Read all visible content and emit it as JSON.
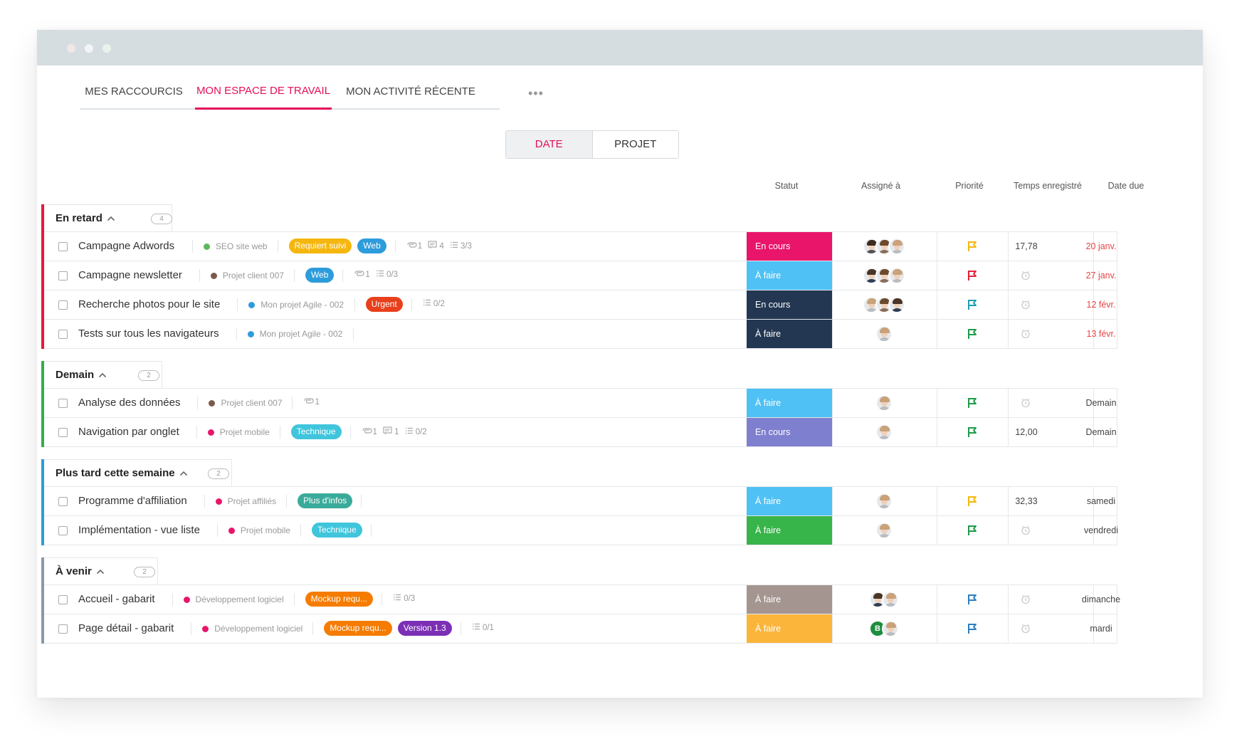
{
  "window": {
    "dots": [
      "#f2e6e8",
      "#f2f4f5",
      "#eaf3ea"
    ]
  },
  "tabs": [
    {
      "label": "MES RACCOURCIS",
      "active": false
    },
    {
      "label": "MON ESPACE DE TRAVAIL",
      "active": true
    },
    {
      "label": "MON ACTIVITÉ RÉCENTE",
      "active": false
    }
  ],
  "tabs_more": "•••",
  "view_toggle": {
    "date_label": "DATE",
    "project_label": "PROJET",
    "selected": "DATE"
  },
  "columns": {
    "status": "Statut",
    "assignee": "Assigné à",
    "priority": "Priorité",
    "time": "Temps enregistré",
    "due": "Date due"
  },
  "groups": [
    {
      "title": "En retard",
      "count": "4",
      "color": "#e8173a",
      "tasks": [
        {
          "name": "Campagne Adwords",
          "project": "SEO site web",
          "project_color": "#5cb85c",
          "tags": [
            {
              "label": "Requiert suivi",
              "color": "#f5b70f"
            },
            {
              "label": "Web",
              "color": "#2d9cdb"
            }
          ],
          "meta": {
            "attachments": "1",
            "comments": "4",
            "checklist": "3/3"
          },
          "status": "En cours",
          "status_color": "#e9156a",
          "assignees": [
            "p1",
            "p2",
            "p3"
          ],
          "priority_color": "#f5b70f",
          "time": "17,78",
          "due": "20 janv.",
          "due_late": true
        },
        {
          "name": "Campagne newsletter",
          "project": "Projet client 007",
          "project_color": "#7a5a4a",
          "tags": [
            {
              "label": "Web",
              "color": "#2d9cdb"
            }
          ],
          "meta": {
            "attachments": "1",
            "comments": "",
            "checklist": "0/3"
          },
          "status": "À faire",
          "status_color": "#4fc1f4",
          "assignees": [
            "p4",
            "p2",
            "p3"
          ],
          "priority_color": "#e5213b",
          "time": "",
          "due": "27 janv.",
          "due_late": true
        },
        {
          "name": "Recherche photos pour le site",
          "project": "Mon projet Agile - 002",
          "project_color": "#2d9cdb",
          "tags": [
            {
              "label": "Urgent",
              "color": "#e8401c"
            }
          ],
          "meta": {
            "attachments": "",
            "comments": "",
            "checklist": "0/2"
          },
          "status": "En cours",
          "status_color": "#233753",
          "assignees": [
            "p3",
            "p2",
            "p4"
          ],
          "priority_color": "#1a9fb0",
          "time": "",
          "due": "12 févr.",
          "due_late": true
        },
        {
          "name": "Tests sur tous les navigateurs",
          "project": "Mon projet Agile - 002",
          "project_color": "#2d9cdb",
          "tags": [],
          "meta": {
            "attachments": "",
            "comments": "",
            "checklist": ""
          },
          "status": "À faire",
          "status_color": "#233753",
          "assignees": [
            "p3"
          ],
          "priority_color": "#1e9b4a",
          "time": "",
          "due": "13 févr.",
          "due_late": true
        }
      ]
    },
    {
      "title": "Demain",
      "count": "2",
      "color": "#2eaf4e",
      "tasks": [
        {
          "name": "Analyse des données",
          "project": "Projet client 007",
          "project_color": "#7a5a4a",
          "tags": [],
          "meta": {
            "attachments": "1",
            "comments": "",
            "checklist": ""
          },
          "status": "À faire",
          "status_color": "#4fc1f4",
          "assignees": [
            "p3"
          ],
          "priority_color": "#1e9b4a",
          "time": "",
          "due": "Demain",
          "due_late": false
        },
        {
          "name": "Navigation par onglet",
          "project": "Projet mobile",
          "project_color": "#e9156a",
          "tags": [
            {
              "label": "Technique",
              "color": "#3fc5dc"
            }
          ],
          "meta": {
            "attachments": "1",
            "comments": "1",
            "checklist": "0/2"
          },
          "status": "En cours",
          "status_color": "#7f7fcf",
          "assignees": [
            "p3"
          ],
          "priority_color": "#1e9b4a",
          "time": "12,00",
          "due": "Demain",
          "due_late": false
        }
      ]
    },
    {
      "title": "Plus tard cette semaine",
      "count": "2",
      "color": "#2d9cdb",
      "tasks": [
        {
          "name": "Programme d'affiliation",
          "project": "Projet affiliés",
          "project_color": "#e9156a",
          "tags": [
            {
              "label": "Plus d'infos",
              "color": "#3aab9a"
            }
          ],
          "meta": {
            "attachments": "",
            "comments": "",
            "checklist": ""
          },
          "status": "À faire",
          "status_color": "#4fc1f4",
          "assignees": [
            "p3"
          ],
          "priority_color": "#f5b70f",
          "time": "32,33",
          "due": "samedi",
          "due_late": false
        },
        {
          "name": "Implémentation - vue liste",
          "project": "Projet mobile",
          "project_color": "#e9156a",
          "tags": [
            {
              "label": "Technique",
              "color": "#3fc5dc"
            }
          ],
          "meta": {
            "attachments": "",
            "comments": "",
            "checklist": ""
          },
          "status": "À faire",
          "status_color": "#37b44a",
          "assignees": [
            "p3"
          ],
          "priority_color": "#1e9b4a",
          "time": "",
          "due": "vendredi",
          "due_late": false
        }
      ]
    },
    {
      "title": "À venir",
      "count": "2",
      "color": "#8a99a8",
      "tasks": [
        {
          "name": "Accueil - gabarit",
          "project": "Développement logiciel",
          "project_color": "#e9156a",
          "tags": [
            {
              "label": "Mockup requ...",
              "color": "#f57c00"
            }
          ],
          "meta": {
            "attachments": "",
            "comments": "",
            "checklist": "0/3"
          },
          "status": "À faire",
          "status_color": "#a59590",
          "assignees": [
            "p4",
            "p3"
          ],
          "priority_color": "#2d7fc0",
          "time": "",
          "due": "dimanche",
          "due_late": false
        },
        {
          "name": "Page détail - gabarit",
          "project": "Développement logiciel",
          "project_color": "#e9156a",
          "tags": [
            {
              "label": "Mockup requ...",
              "color": "#f57c00"
            },
            {
              "label": "Version 1.3",
              "color": "#7b2fb5"
            }
          ],
          "meta": {
            "attachments": "",
            "comments": "",
            "checklist": "0/1"
          },
          "status": "À faire",
          "status_color": "#fbb53a",
          "assignees": [
            "B",
            "p3"
          ],
          "priority_color": "#2d7fc0",
          "time": "",
          "due": "mardi",
          "due_late": false
        }
      ]
    }
  ]
}
